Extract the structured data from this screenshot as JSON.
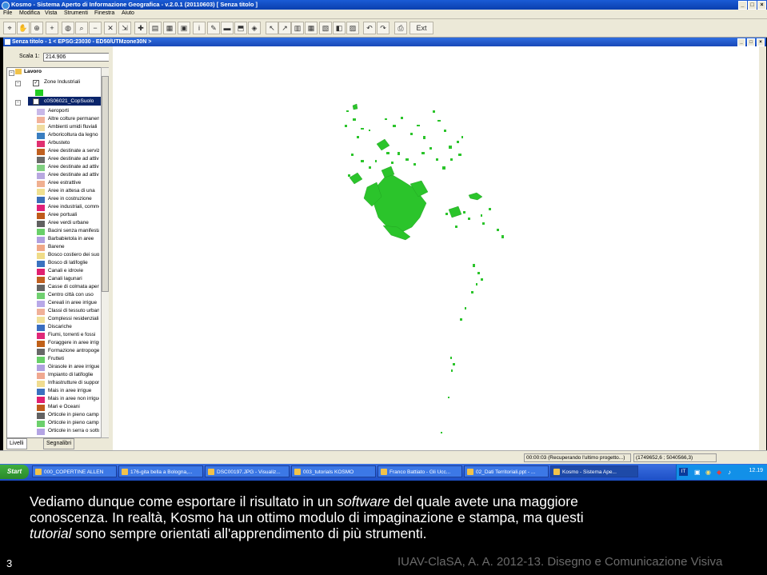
{
  "window": {
    "title": "Kosmo - Sistema Aperto di Informazione Geografica - v.2.0.1 (20110603) [ Senza titolo ]",
    "controls": [
      "_",
      "□",
      "×"
    ]
  },
  "menu": [
    "File",
    "Modifica",
    "Vista",
    "Strumenti",
    "Finestra",
    "Aiuto"
  ],
  "toolbar": {
    "exit_label": "Ext"
  },
  "document": {
    "title": "Senza titolo - 1  < EPSG:23030 - ED50/UTMzone30N >",
    "controls": [
      "_",
      "□",
      "×"
    ]
  },
  "left_panel": {
    "scale_label": "Scala 1:",
    "scale_value": "214.906",
    "tree": {
      "root": "Lavoro",
      "layer1": "Zone Industriali",
      "layer1_color": "#22cc22",
      "layer2": "c0S06021_CopSuolo"
    },
    "legend": [
      {
        "label": "Aeroporti",
        "color": "#c8b8e8"
      },
      {
        "label": "Altre colture permanenti",
        "color": "#f2b29a"
      },
      {
        "label": "Ambienti umidi fluviali",
        "color": "#f0dca0"
      },
      {
        "label": "Arboricoltura da legno",
        "color": "#3a7ec0"
      },
      {
        "label": "Arbusteto",
        "color": "#e03070"
      },
      {
        "label": "Aree destinate a servizi",
        "color": "#c06020"
      },
      {
        "label": "Aree destinate ad attività",
        "color": "#6a6a6a"
      },
      {
        "label": "Aree destinate ad attività",
        "color": "#80d080"
      },
      {
        "label": "Aree destinate ad attività",
        "color": "#b8a8e0"
      },
      {
        "label": "Aree estrattive",
        "color": "#f0b090"
      },
      {
        "label": "Aree in attesa di una",
        "color": "#f0e090"
      },
      {
        "label": "Aree in costruzione",
        "color": "#3a6eb8"
      },
      {
        "label": "Aree industriali, commerciali",
        "color": "#e0207a"
      },
      {
        "label": "Aree portuali",
        "color": "#c05a1a"
      },
      {
        "label": "Aree verdi urbane",
        "color": "#606060"
      },
      {
        "label": "Bacini senza manifesta",
        "color": "#6ad06a"
      },
      {
        "label": "Barbabietola in aree",
        "color": "#b0a0e0"
      },
      {
        "label": "Barene",
        "color": "#f0a888"
      },
      {
        "label": "Bosco costiero dei suoli",
        "color": "#f0dc88"
      },
      {
        "label": "Bosco di latifoglie",
        "color": "#3a72c0"
      },
      {
        "label": "Canali e idrovie",
        "color": "#e02070"
      },
      {
        "label": "Canali lagunari",
        "color": "#c06020"
      },
      {
        "label": "Casse di colmata apertе",
        "color": "#646464"
      },
      {
        "label": "Centro città con uso",
        "color": "#70d070"
      },
      {
        "label": "Cereali in aree irrigue",
        "color": "#b8a8e8"
      },
      {
        "label": "Classi di tessuto urbano",
        "color": "#f0b098"
      },
      {
        "label": "Complessi residenziali",
        "color": "#f0e098"
      },
      {
        "label": "Discariche",
        "color": "#3a6ec0"
      },
      {
        "label": "Fiumi, torrenti e fossi",
        "color": "#e02878"
      },
      {
        "label": "Foraggere in aree irrigue",
        "color": "#c06018"
      },
      {
        "label": "Formazione antropogena",
        "color": "#686868"
      },
      {
        "label": "Frutteti",
        "color": "#68d068"
      },
      {
        "label": "Girasole in aree irrigue",
        "color": "#b0a0e0"
      },
      {
        "label": "Impianto di latifoglie",
        "color": "#f0a890"
      },
      {
        "label": "Infrastrutture di supporto",
        "color": "#f0dc90"
      },
      {
        "label": "Mais in aree irrigue",
        "color": "#3a70c0"
      },
      {
        "label": "Mais in aree non irrigue",
        "color": "#e02070"
      },
      {
        "label": "Mari e Oceani",
        "color": "#c05c1c"
      },
      {
        "label": "Orticole in pieno campo",
        "color": "#626262"
      },
      {
        "label": "Orticole in pieno campo",
        "color": "#6cd06c"
      },
      {
        "label": "Orticole in serra o sotto",
        "color": "#b4a4e4"
      }
    ],
    "tabs": [
      "Livelli",
      "Segnalibri"
    ]
  },
  "status": {
    "message": "00:00:03 (Recuperando l'ultimo progetto...)",
    "coords": "(1749652,6 ; 5040566,3)"
  },
  "taskbar": {
    "start": "Start",
    "tasks": [
      "000_COPERTINE ALLEN",
      "176-gita bella a Bologna,...",
      "DSC00197.JPG - Visualiz...",
      "003_tutorials KOSMO",
      "Franco Battiato - Gli Ucc...",
      "02_Dati Territoriali.ppt - ...",
      "Kosmo - Sistema Ape..."
    ],
    "lang": "IT",
    "clock": "12.19"
  },
  "slide": {
    "line1_a": "Vediamo dunque come esportare il risultato in un ",
    "line1_em": "software",
    "line1_b": " del quale avete una maggiore",
    "line2": "conoscenza. In realtà, Kosmo ha un ottimo modulo di impaginazione e stampa, ma questi",
    "line3_em": "tutorial",
    "line3_b": " sono sempre orientati all'apprendimento di più strumenti.",
    "page_number": "3",
    "footer": "IUAV-ClaSA, A. A. 2012-13. Disegno e Comunicazione Visiva"
  },
  "colors": {
    "map_feature": "#2bc42b",
    "titlebar": "#0a3fae",
    "background": "#000000"
  }
}
